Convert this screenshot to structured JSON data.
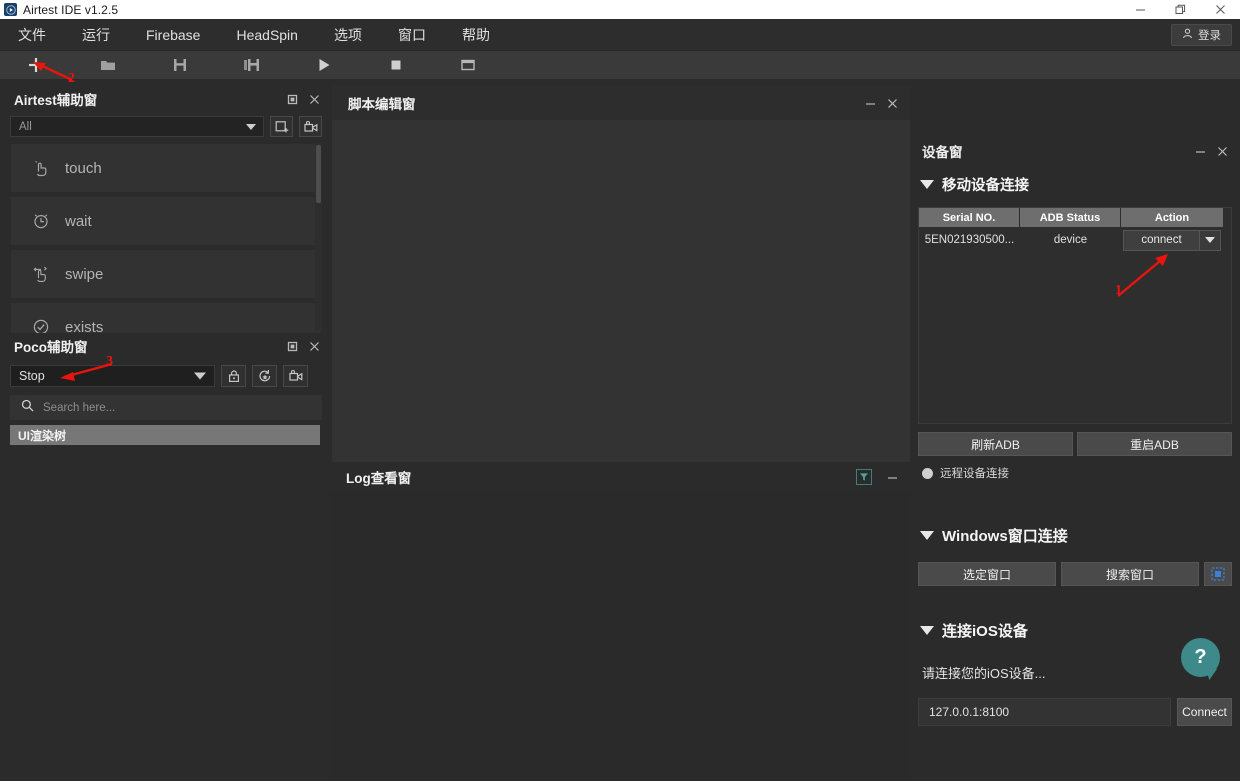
{
  "window": {
    "title": "Airtest IDE v1.2.5",
    "controls": {
      "minimize": "minimize-icon",
      "restore": "restore-icon",
      "close": "close-icon"
    }
  },
  "menubar": {
    "items": [
      {
        "label": "文件",
        "name": "menu-file"
      },
      {
        "label": "运行",
        "name": "menu-run"
      },
      {
        "label": "Firebase",
        "name": "menu-firebase"
      },
      {
        "label": "HeadSpin",
        "name": "menu-headspin"
      },
      {
        "label": "选项",
        "name": "menu-options"
      },
      {
        "label": "窗口",
        "name": "menu-window"
      },
      {
        "label": "帮助",
        "name": "menu-help"
      }
    ],
    "login_label": "登录"
  },
  "toolbar": {
    "buttons": [
      {
        "name": "new-file-button",
        "icon": "plus-icon"
      },
      {
        "name": "open-file-button",
        "icon": "folder-icon"
      },
      {
        "name": "save-button",
        "icon": "save-icon"
      },
      {
        "name": "save-as-button",
        "icon": "save-as-icon"
      },
      {
        "name": "run-button",
        "icon": "play-icon"
      },
      {
        "name": "stop-button",
        "icon": "stop-icon"
      },
      {
        "name": "report-button",
        "icon": "window-icon"
      }
    ]
  },
  "airtest_panel": {
    "title": "Airtest辅助窗",
    "filter_value": "All",
    "buttons": [
      {
        "name": "snapshot-button",
        "icon": "snapshot-icon"
      },
      {
        "name": "record-button",
        "icon": "record-icon"
      }
    ],
    "actions": [
      {
        "label": "touch",
        "icon": "touch-icon"
      },
      {
        "label": "wait",
        "icon": "clock-icon"
      },
      {
        "label": "swipe",
        "icon": "swipe-icon"
      },
      {
        "label": "exists",
        "icon": "check-circle-icon"
      }
    ]
  },
  "poco_panel": {
    "title": "Poco辅助窗",
    "mode_value": "Stop",
    "buttons": [
      {
        "name": "lock-button",
        "icon": "lock-icon"
      },
      {
        "name": "refresh-button",
        "icon": "refresh-star-icon"
      },
      {
        "name": "poco-record-button",
        "icon": "record-icon"
      }
    ],
    "search_placeholder": "Search here...",
    "tree_root": "UI渲染树"
  },
  "script_panel": {
    "title": "脚本编辑窗"
  },
  "log_panel": {
    "title": "Log查看窗",
    "filter_icon": "filter-icon"
  },
  "device_panel": {
    "title": "设备窗",
    "mobile_section": "移动设备连接",
    "table": {
      "headers": [
        "Serial NO.",
        "ADB Status",
        "Action"
      ],
      "rows": [
        {
          "serial": "5EN021930500...",
          "status": "device",
          "action": "connect"
        }
      ]
    },
    "refresh_adb": "刷新ADB",
    "restart_adb": "重启ADB",
    "remote_device": "远程设备连接",
    "windows_section": "Windows窗口连接",
    "select_window": "选定窗口",
    "search_window": "搜索窗口",
    "ios_section": "连接iOS设备",
    "ios_hint": "请连接您的iOS设备...",
    "ios_address": "127.0.0.1:8100",
    "ios_connect": "Connect",
    "help_label": "?"
  },
  "annotations": [
    {
      "id": "1",
      "label": "1"
    },
    {
      "id": "2",
      "label": "2"
    },
    {
      "id": "3",
      "label": "3"
    }
  ],
  "colors": {
    "accent_red": "#e8150f",
    "teal": "#3e8a8a",
    "panel_bg": "#2b2b2b",
    "editor_bg": "#333333",
    "header_gray": "#6e6e6e"
  }
}
